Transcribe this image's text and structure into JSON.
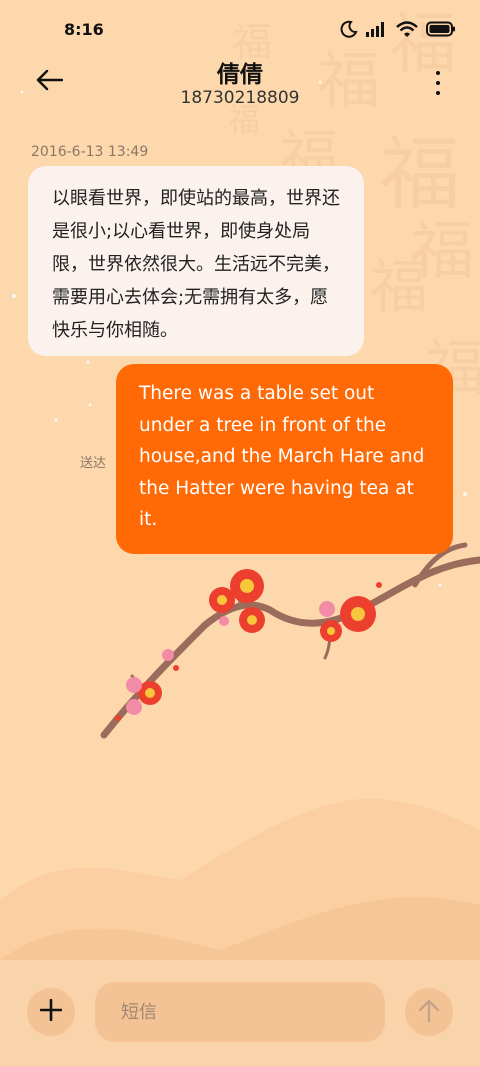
{
  "status_bar": {
    "time": "8:16",
    "icons": [
      "moon-icon",
      "signal-icon",
      "wifi-icon",
      "battery-icon"
    ]
  },
  "header": {
    "contact_name": "倩倩",
    "phone_number": "18730218809",
    "icons": [
      "back-arrow-icon",
      "more-options-icon"
    ]
  },
  "conversation": {
    "timestamp": "2016-6-13 13:49",
    "incoming_message": "以眼看世界，即使站的最高，世界还是很小;以心看世界，即使身处局限，世界依然很大。生活远不完美，需要用心去体会;无需拥有太多，愿快乐与你相随。",
    "outgoing_message": "There was a table set out under a tree in front of the house,and the March Hare and the Hatter were having tea at it.",
    "sent_status": "送达"
  },
  "composer": {
    "placeholder": "短信",
    "value": "",
    "icons": [
      "add-icon",
      "send-arrow-icon"
    ]
  },
  "colors": {
    "background": "#fed8ad",
    "incoming_bubble": "#fbf2ee",
    "outgoing_bubble": "#ff6a06",
    "composer_bar": "#f9d3aa",
    "composer_button": "#f3c395",
    "blossom": "#ec3f2e",
    "branch": "#9b6c5b"
  }
}
